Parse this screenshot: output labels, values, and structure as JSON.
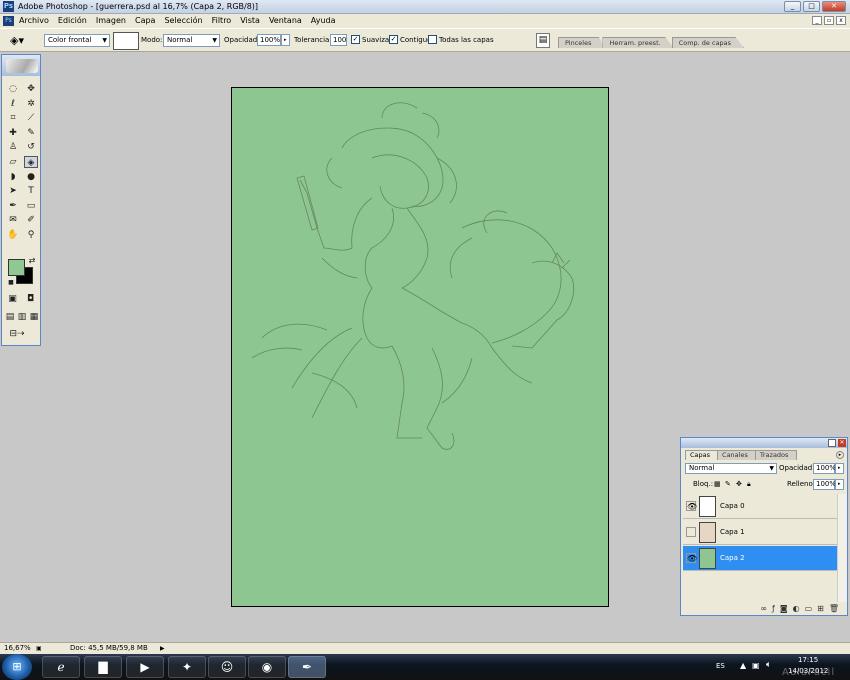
{
  "window": {
    "title": "Adobe Photoshop - [guerrera.psd al 16,7% (Capa 2, RGB/8)]",
    "app_icon": "Ps",
    "minimize": "_",
    "maximize": "□",
    "close": "✕"
  },
  "menu": {
    "items": [
      "Archivo",
      "Edición",
      "Imagen",
      "Capa",
      "Selección",
      "Filtro",
      "Vista",
      "Ventana",
      "Ayuda"
    ],
    "doc_controls": [
      "_",
      "▫",
      "x"
    ]
  },
  "options": {
    "fill_source": "Color frontal",
    "mode_label": "Modo:",
    "mode_value": "Normal",
    "opacity_label": "Opacidad:",
    "opacity_value": "100%",
    "tolerance_label": "Tolerancia:",
    "tolerance_value": "100",
    "antialias_label": "Suavizar",
    "antialias_checked": true,
    "contiguous_label": "Contiguo",
    "contiguous_checked": true,
    "all_layers_label": "Todas las capas",
    "all_layers_checked": false,
    "palette_tabs": [
      "Pinceles",
      "Herram. preest.",
      "Comp. de capas"
    ]
  },
  "toolbox": {
    "tools": [
      {
        "name": "marquee-icon",
        "glyph": "◌"
      },
      {
        "name": "move-icon",
        "glyph": "✥"
      },
      {
        "name": "lasso-icon",
        "glyph": "ℓ"
      },
      {
        "name": "magic-wand-icon",
        "glyph": "✲"
      },
      {
        "name": "crop-icon",
        "glyph": "⌗"
      },
      {
        "name": "slice-icon",
        "glyph": "⟋"
      },
      {
        "name": "healing-brush-icon",
        "glyph": "✚"
      },
      {
        "name": "brush-icon",
        "glyph": "✎"
      },
      {
        "name": "clone-stamp-icon",
        "glyph": "♙"
      },
      {
        "name": "history-brush-icon",
        "glyph": "↺"
      },
      {
        "name": "eraser-icon",
        "glyph": "▱"
      },
      {
        "name": "paint-bucket-icon",
        "glyph": "◈"
      },
      {
        "name": "blur-icon",
        "glyph": "◗"
      },
      {
        "name": "dodge-icon",
        "glyph": "●"
      },
      {
        "name": "path-selection-icon",
        "glyph": "➤"
      },
      {
        "name": "type-icon",
        "glyph": "T"
      },
      {
        "name": "pen-icon",
        "glyph": "✒"
      },
      {
        "name": "rectangle-icon",
        "glyph": "▭"
      },
      {
        "name": "notes-icon",
        "glyph": "✉"
      },
      {
        "name": "eyedropper-icon",
        "glyph": "✐"
      },
      {
        "name": "hand-icon",
        "glyph": "✋"
      },
      {
        "name": "zoom-icon",
        "glyph": "⚲"
      }
    ],
    "foreground_color": "#8fc893",
    "background_color": "#000000"
  },
  "document": {
    "fill_color": "#8ec691"
  },
  "layers_panel": {
    "tabs": [
      "Capas",
      "Canales",
      "Trazados"
    ],
    "blend_mode": "Normal",
    "opacity_label": "Opacidad:",
    "opacity_value": "100%",
    "lock_label": "Bloq.:",
    "fill_label": "Relleno:",
    "fill_value": "100%",
    "layers": [
      {
        "name": "Capa 0",
        "visible": true,
        "selected": false
      },
      {
        "name": "Capa 1",
        "visible": false,
        "selected": false
      },
      {
        "name": "Capa 2",
        "visible": true,
        "selected": true
      }
    ]
  },
  "statusbar": {
    "zoom": "16,67%",
    "doc_info": "Doc: 45,5 MB/59,8 MB"
  },
  "taskbar": {
    "language": "ES",
    "time": "17:15",
    "date": "14/03/2012",
    "watermark": "AulaFacil"
  }
}
